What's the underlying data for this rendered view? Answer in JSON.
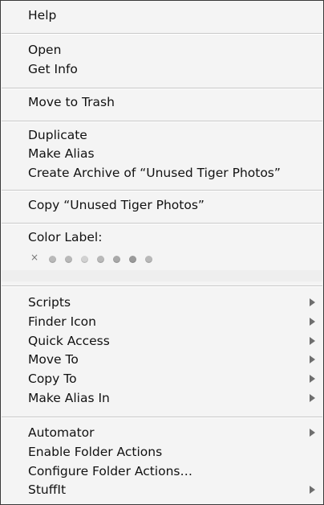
{
  "menu": {
    "help": "Help",
    "open": "Open",
    "get_info": "Get Info",
    "move_to_trash": "Move to Trash",
    "duplicate": "Duplicate",
    "make_alias": "Make Alias",
    "create_archive": "Create Archive of “Unused Tiger Photos”",
    "copy": "Copy “Unused Tiger Photos”",
    "color_label": "Color Label:",
    "color_label_clear_symbol": "×",
    "scripts": "Scripts",
    "finder_icon": "Finder Icon",
    "quick_access": "Quick Access",
    "move_to": "Move To",
    "copy_to": "Copy To",
    "make_alias_in": "Make Alias In",
    "automator": "Automator",
    "enable_folder_actions": "Enable Folder Actions",
    "configure_folder_actions": "Configure Folder Actions…",
    "stuffit": "StuffIt"
  },
  "colors": {
    "menu_background": "#f4f4f4",
    "text": "#111111",
    "submenu_arrow": "#6e6e6e"
  }
}
